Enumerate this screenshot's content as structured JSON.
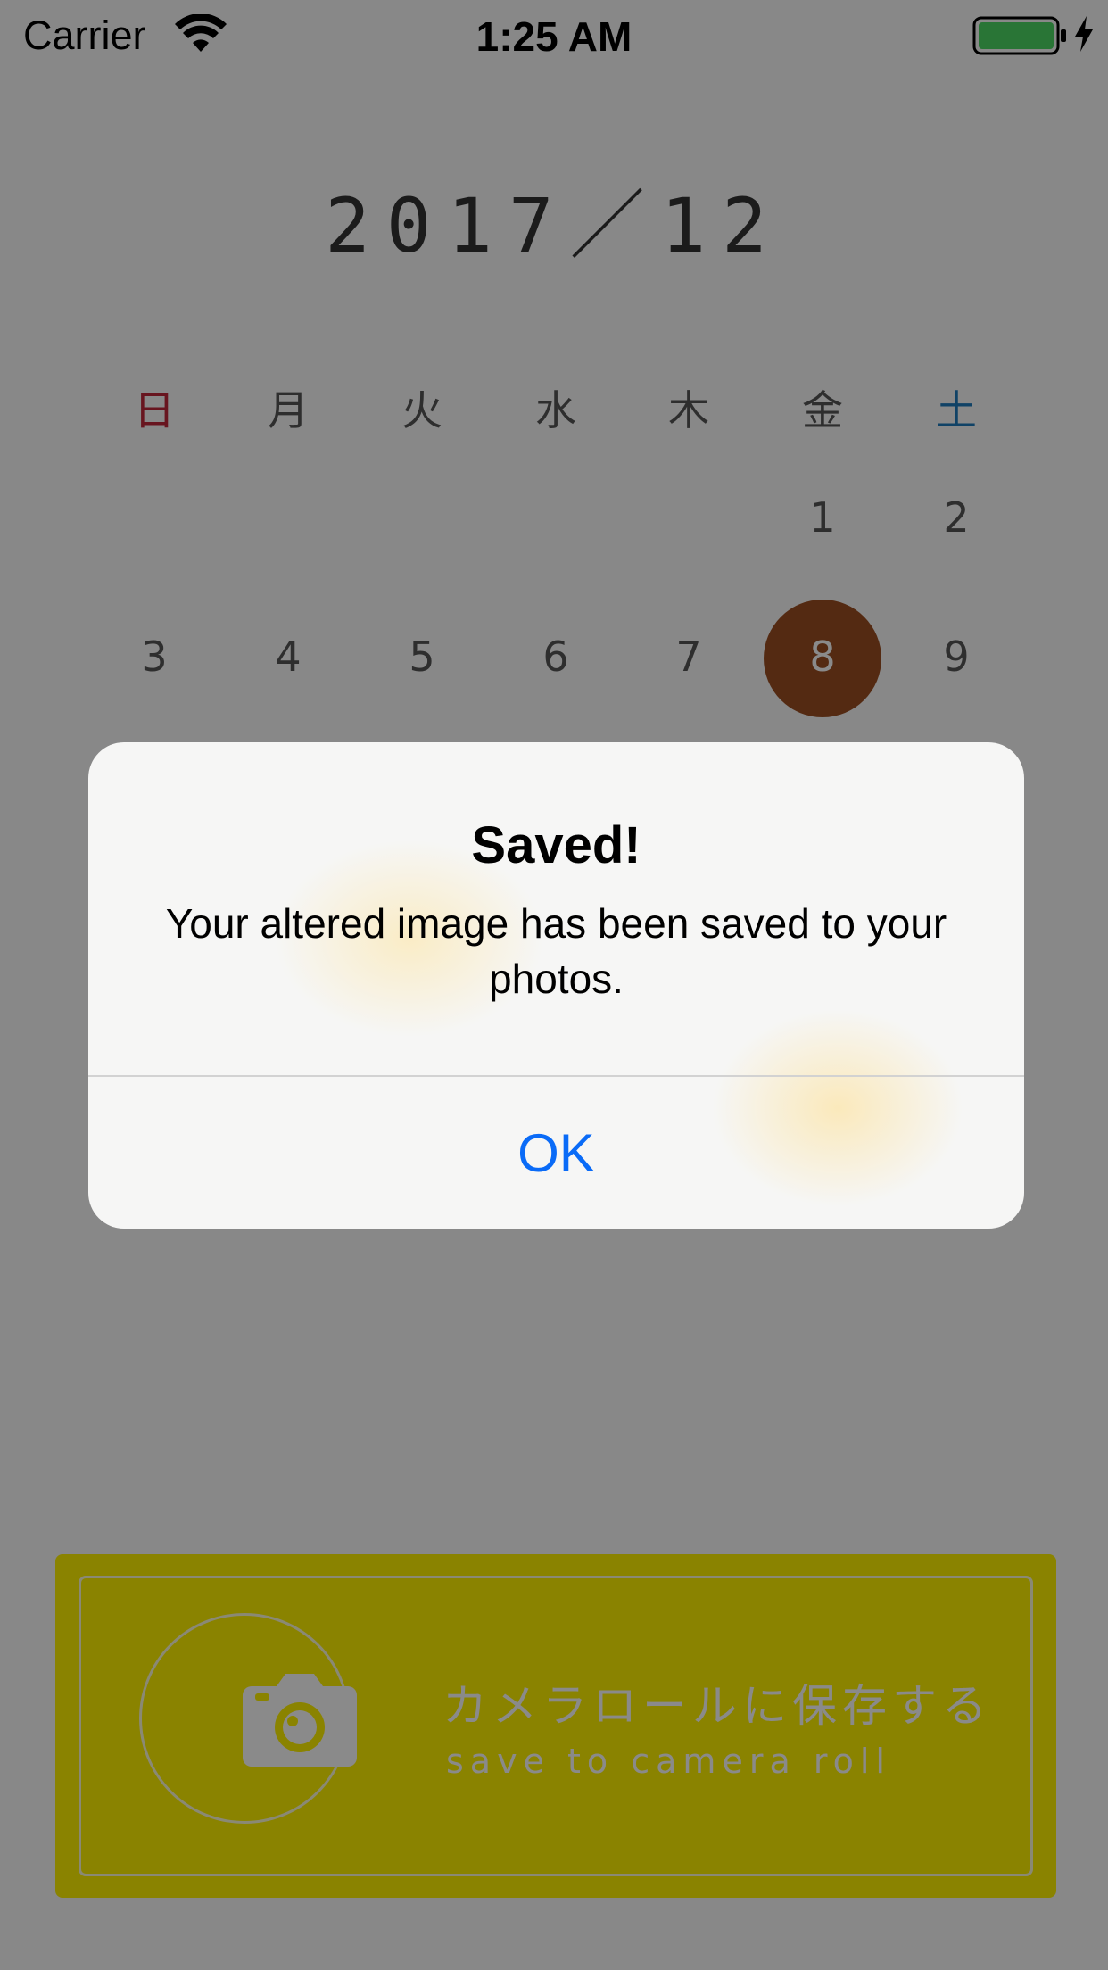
{
  "status_bar": {
    "carrier": "Carrier",
    "time": "1:25 AM",
    "battery_color": "#4cd964",
    "icons": [
      "wifi-icon",
      "battery-icon",
      "charging-icon"
    ]
  },
  "calendar": {
    "title": "2017／12",
    "weekdays": [
      "日",
      "月",
      "火",
      "水",
      "木",
      "金",
      "土"
    ],
    "sunday_color": "#c0283a",
    "saturday_color": "#1e7bbd",
    "rows": [
      [
        "",
        "",
        "",
        "",
        "",
        "1",
        "2"
      ],
      [
        "3",
        "4",
        "5",
        "6",
        "7",
        "8",
        "9"
      ]
    ],
    "selected_day": "8",
    "selected_color": "#9b4f22"
  },
  "save_button": {
    "label_jp": "カメラロールに保存する",
    "label_en": "save to camera roll",
    "icon": "camera-icon",
    "background_color": "#fff200"
  },
  "alert": {
    "title": "Saved!",
    "message": "Your altered image has been saved to your photos.",
    "ok_label": "OK",
    "ok_color": "#0a6bf7"
  }
}
